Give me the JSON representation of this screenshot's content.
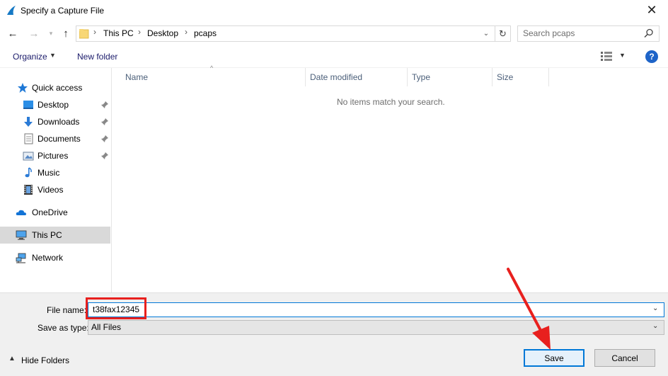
{
  "window": {
    "title": "Specify a Capture File"
  },
  "address": {
    "crumbs": [
      "This PC",
      "Desktop",
      "pcaps"
    ]
  },
  "search": {
    "placeholder": "Search pcaps"
  },
  "commands": {
    "organize": "Organize",
    "new_folder": "New folder"
  },
  "sidebar": {
    "items": [
      {
        "label": "Quick access",
        "icon": "star-icon"
      },
      {
        "label": "Desktop",
        "icon": "desktop-icon",
        "pinned": true
      },
      {
        "label": "Downloads",
        "icon": "download-icon",
        "pinned": true
      },
      {
        "label": "Documents",
        "icon": "documents-icon",
        "pinned": true
      },
      {
        "label": "Pictures",
        "icon": "pictures-icon",
        "pinned": true
      },
      {
        "label": "Music",
        "icon": "music-icon"
      },
      {
        "label": "Videos",
        "icon": "videos-icon"
      },
      {
        "label": "OneDrive",
        "icon": "cloud-icon"
      },
      {
        "label": "This PC",
        "icon": "computer-icon",
        "selected": true
      },
      {
        "label": "Network",
        "icon": "network-icon"
      }
    ]
  },
  "filelist": {
    "columns": [
      "Name",
      "Date modified",
      "Type",
      "Size"
    ],
    "empty_message": "No items match your search."
  },
  "form": {
    "file_name_label": "File name:",
    "file_name_value": "t38fax12345",
    "save_type_label": "Save as type:",
    "save_type_value": "All Files"
  },
  "footer": {
    "hide_folders": "Hide Folders",
    "save": "Save",
    "cancel": "Cancel"
  },
  "colors": {
    "accent": "#0078d7",
    "annotation": "#e8201e"
  }
}
